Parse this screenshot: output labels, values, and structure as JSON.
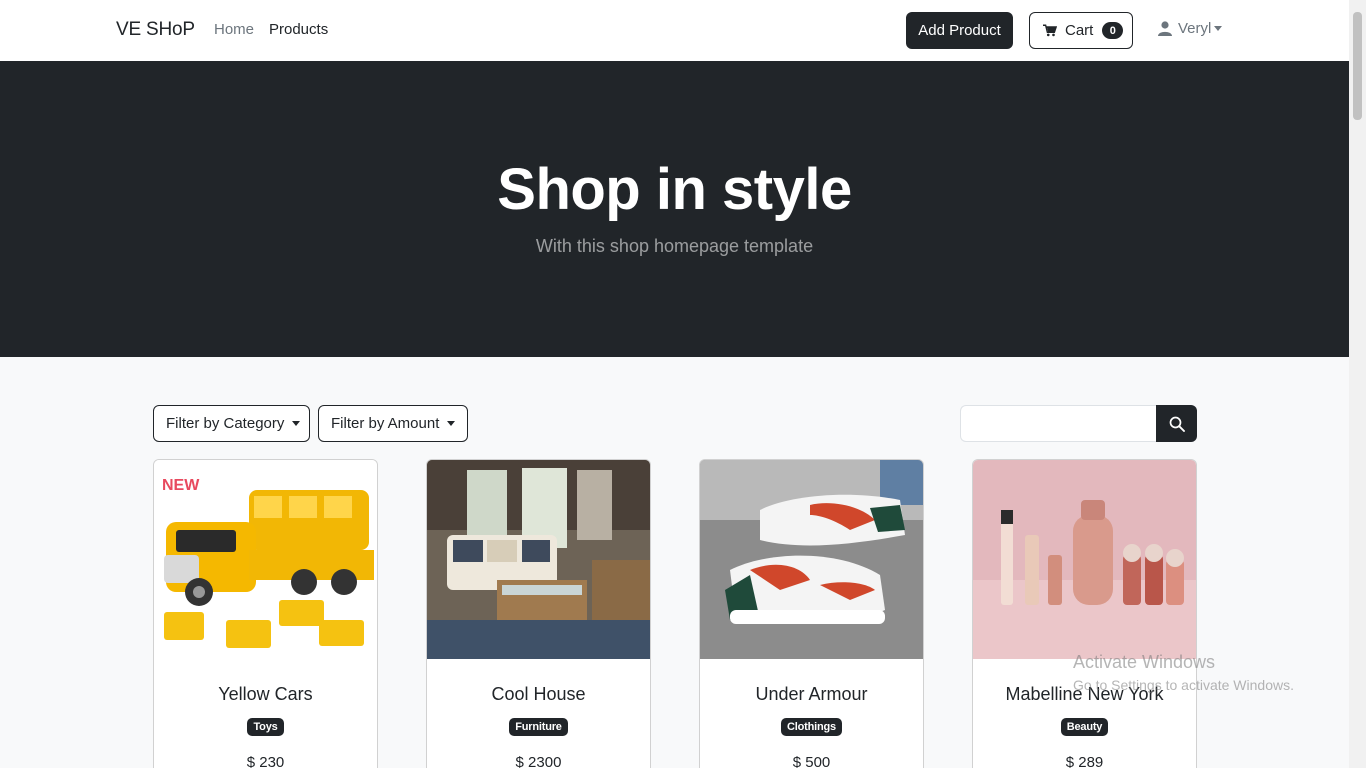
{
  "navbar": {
    "brand": "VE SHoP",
    "links": [
      {
        "label": "Home"
      },
      {
        "label": "Products"
      }
    ],
    "add_product_label": "Add Product",
    "cart": {
      "label": "Cart",
      "count": "0"
    },
    "user": {
      "name": "Veryl"
    }
  },
  "hero": {
    "title": "Shop in style",
    "subtitle": "With this shop homepage template"
  },
  "filters": {
    "category_label": "Filter by Category",
    "amount_label": "Filter by Amount",
    "search_value": ""
  },
  "products": [
    {
      "name": "Yellow Cars",
      "category": "Toys",
      "price": "$ 230"
    },
    {
      "name": "Cool House",
      "category": "Furniture",
      "price": "$ 2300"
    },
    {
      "name": "Under Armour",
      "category": "Clothings",
      "price": "$ 500"
    },
    {
      "name": "Mabelline New York",
      "category": "Beauty",
      "price": "$ 289"
    }
  ],
  "watermark": {
    "line1": "Activate Windows",
    "line2": "Go to Settings to activate Windows."
  },
  "colors": {
    "dark": "#212529",
    "muted": "#6c757d",
    "background": "#f8f9fa"
  },
  "icons": [
    "cart-icon",
    "user-icon",
    "search-icon",
    "caret-down-icon"
  ]
}
